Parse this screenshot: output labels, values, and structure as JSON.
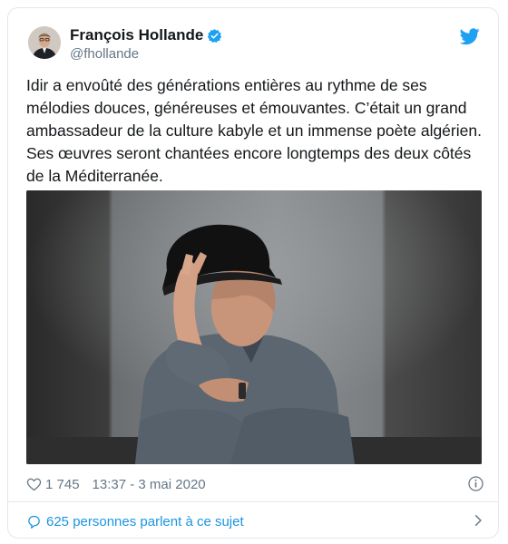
{
  "tweet": {
    "display_name": "François Hollande",
    "handle": "@fhollande",
    "text": "Idir a envoûté des générations entières au rythme de ses mélodies douces, généreuses et émouvantes. C’était un grand ambassadeur de la culture kabyle et un immense poète algérien. Ses œuvres seront chantées encore longtemps des deux côtés de la Méditerranée.",
    "like_count": "1 745",
    "timestamp": "13:37 - 3 mai 2020",
    "conversation_link": "625 personnes parlent à ce sujet"
  },
  "icons": {
    "verified": "verified-badge-icon",
    "brand": "twitter-bird-icon",
    "like": "heart-icon",
    "info": "info-icon",
    "reply": "speech-bubble-icon",
    "chevron": "chevron-right-icon"
  },
  "colors": {
    "accent": "#1da1f2",
    "link": "#1b95e0",
    "secondary_text": "#657786",
    "border": "#e1e8ed"
  }
}
